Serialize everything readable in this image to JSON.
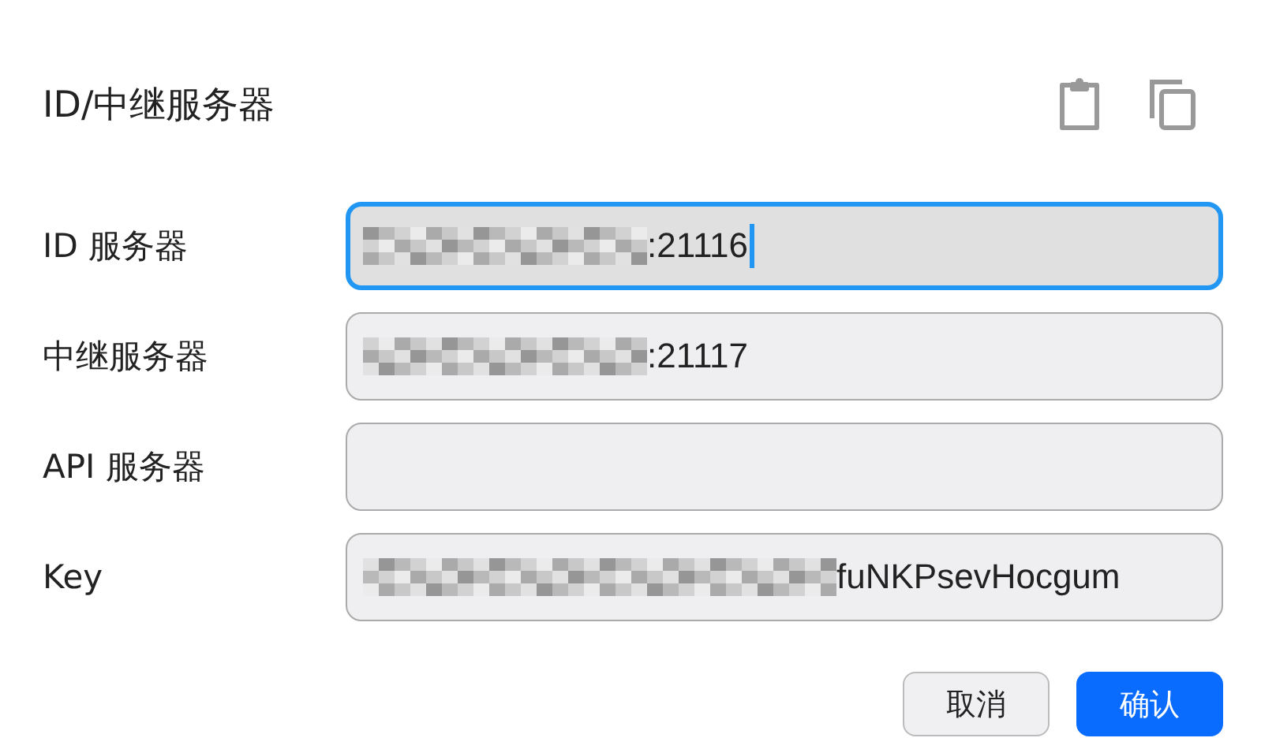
{
  "dialog": {
    "title": "ID/中继服务器"
  },
  "fields": [
    {
      "label": "ID 服务器",
      "value": ":21116",
      "redacted": true,
      "focused": true
    },
    {
      "label": "中继服务器",
      "value": ":21117",
      "redacted": true,
      "focused": false
    },
    {
      "label": "API 服务器",
      "redacted": false,
      "focused": false
    },
    {
      "label": "Key",
      "value": "fuNKPsevHocgum",
      "redacted": true,
      "focused": false
    }
  ],
  "buttons": [
    {
      "label": "取消",
      "kind": "secondary"
    },
    {
      "label": "确认",
      "kind": "primary"
    }
  ]
}
